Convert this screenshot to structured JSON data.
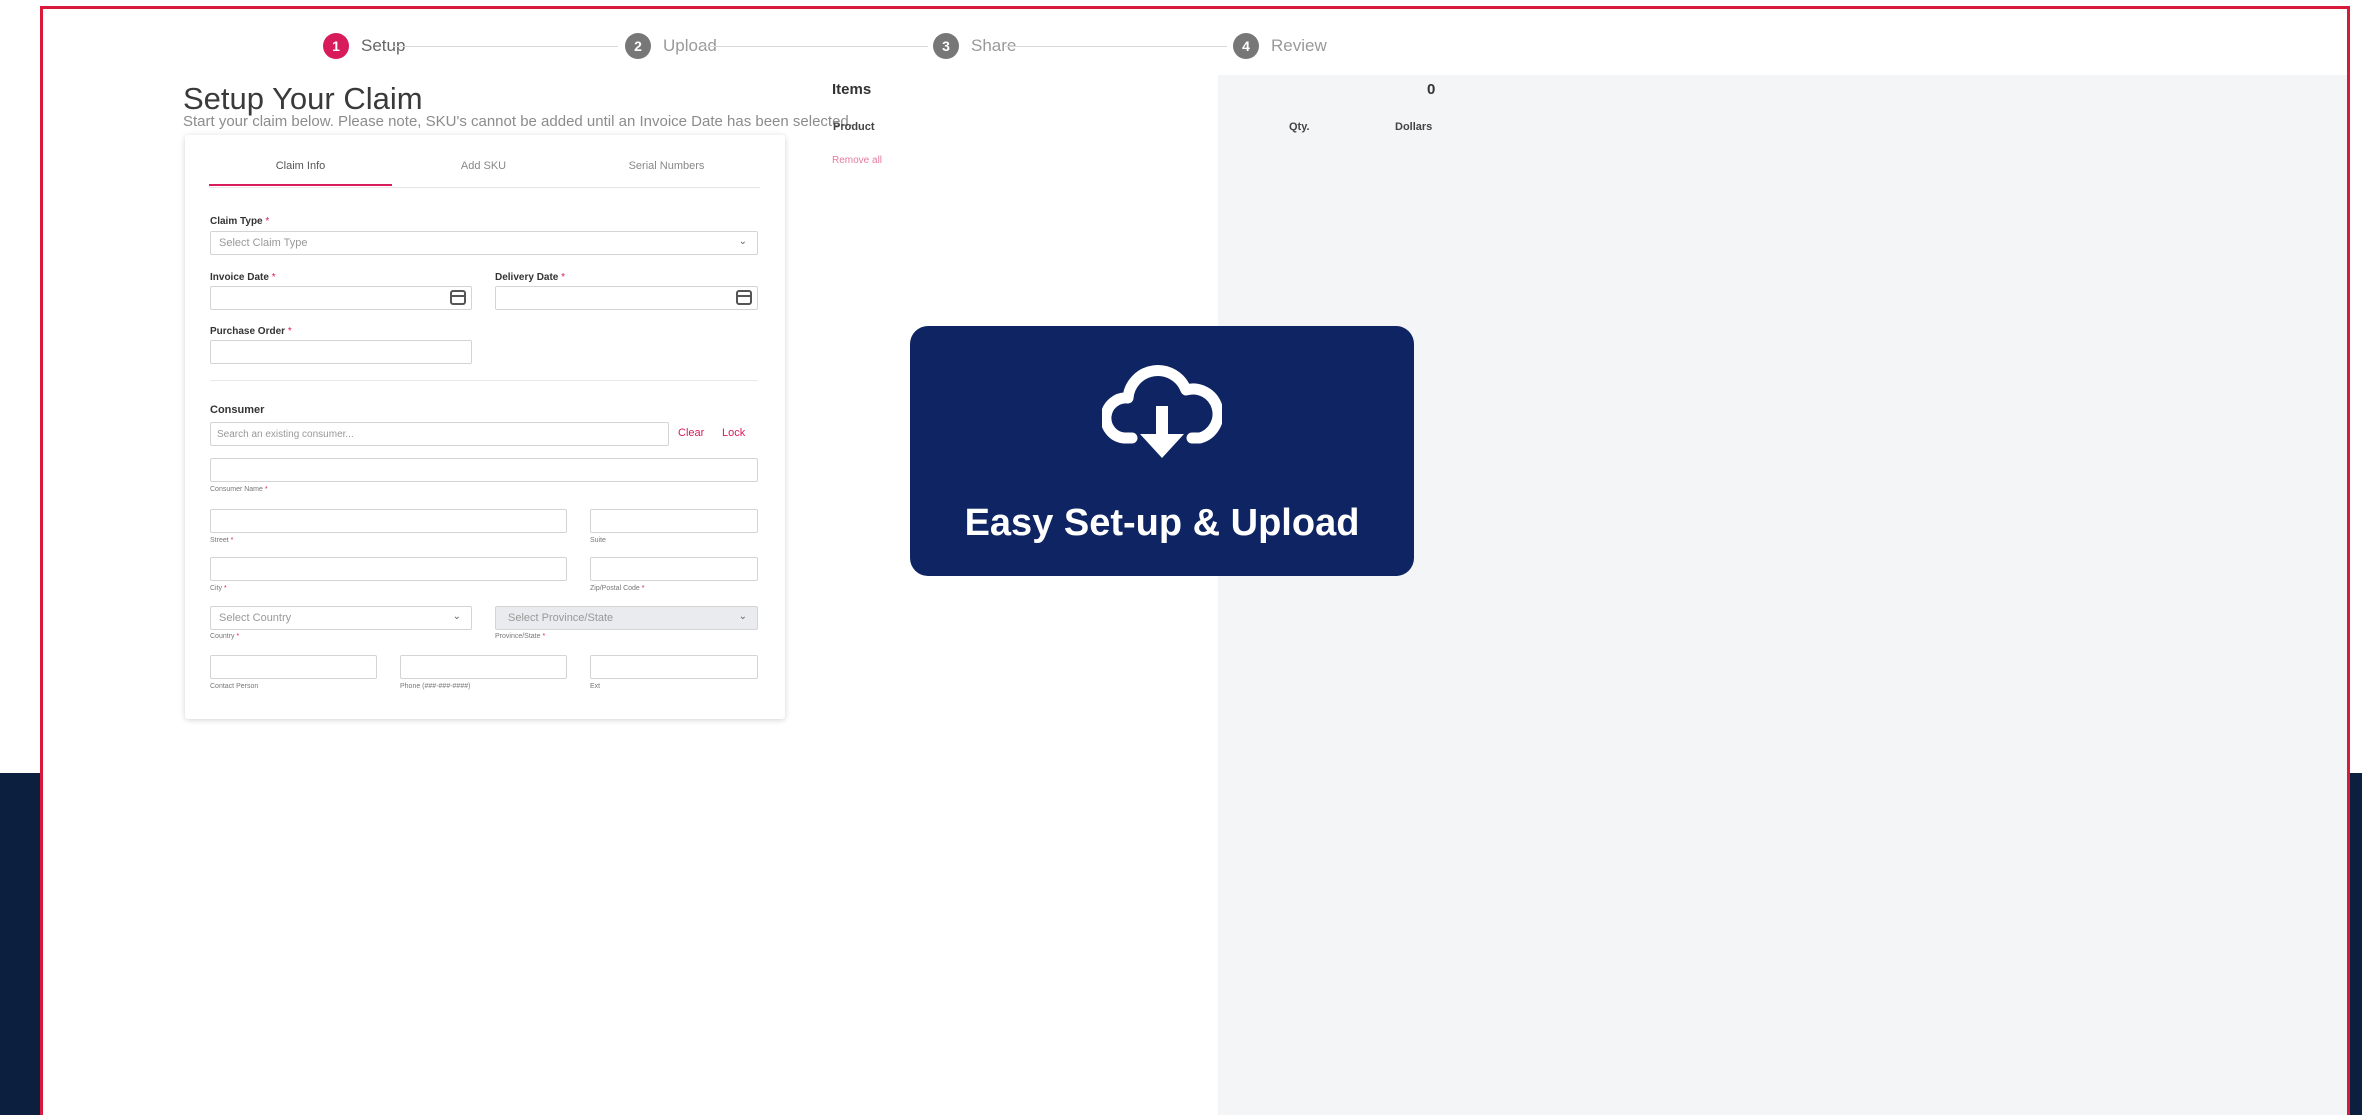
{
  "stepper": {
    "steps": [
      {
        "num": "1",
        "label": "Setup"
      },
      {
        "num": "2",
        "label": "Upload"
      },
      {
        "num": "3",
        "label": "Share"
      },
      {
        "num": "4",
        "label": "Review"
      }
    ]
  },
  "header": {
    "title": "Setup Your Claim",
    "subtitle": "Start your claim below. Please note, SKU's cannot be added until an Invoice Date has been selected."
  },
  "tabs": [
    "Claim Info",
    "Add SKU",
    "Serial Numbers"
  ],
  "form": {
    "claim_type_label": "Claim Type",
    "claim_type_placeholder": "Select Claim Type",
    "invoice_date_label": "Invoice Date",
    "delivery_date_label": "Delivery Date",
    "purchase_order_label": "Purchase Order",
    "required_mark": "*",
    "consumer_heading": "Consumer",
    "consumer_search_placeholder": "Search an existing consumer...",
    "clear_label": "Clear",
    "lock_label": "Lock",
    "consumer_name_label": "Consumer Name",
    "street_label": "Street",
    "suite_label": "Suite",
    "city_label": "City",
    "zip_label": "Zip/Postal Code",
    "country_placeholder": "Select Country",
    "country_label": "Country",
    "province_placeholder": "Select Province/State",
    "province_label": "Province/State",
    "contact_label": "Contact Person",
    "phone_label": "Phone (###-###-####)",
    "ext_label": "Ext"
  },
  "items_panel": {
    "title": "Items",
    "count": "0",
    "col_product": "Product",
    "col_qty": "Qty.",
    "col_dollars": "Dollars",
    "remove_all": "Remove all"
  },
  "promo": {
    "text": "Easy Set-up & Upload",
    "icon": "cloud-download-icon"
  },
  "colors": {
    "accent": "#d81b5a",
    "navy": "#0f2462",
    "band": "#0d1f3f"
  }
}
